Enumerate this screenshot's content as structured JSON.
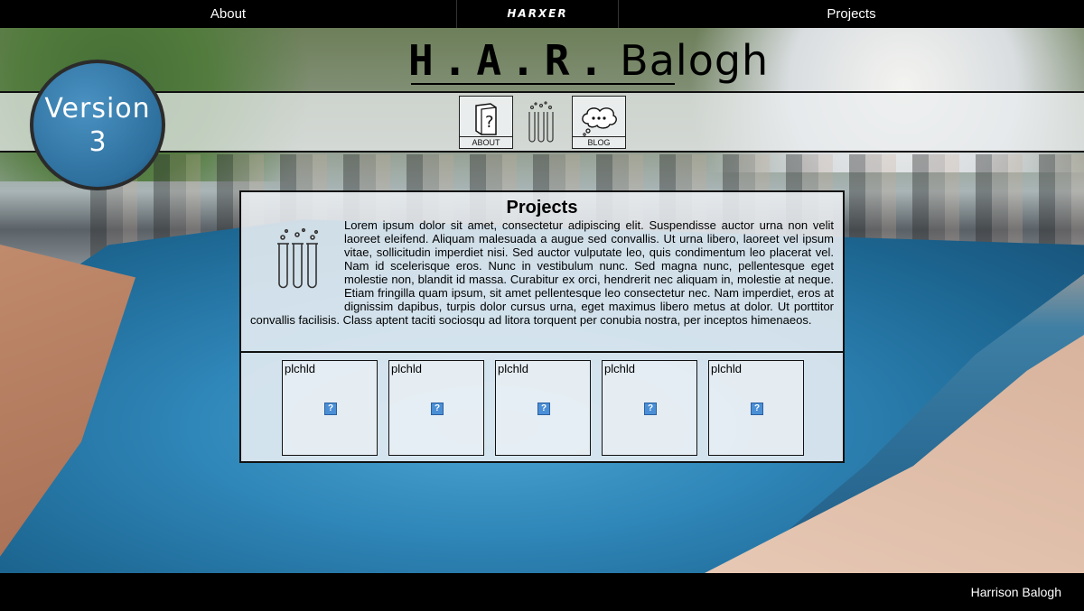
{
  "topnav": {
    "about_label": "About",
    "logo_text": "HARXER",
    "projects_label": "Projects"
  },
  "site_title": {
    "initials": "H.A.R.",
    "surname": "Balogh"
  },
  "version_badge": {
    "label": "Version",
    "number": "3"
  },
  "ribbon": {
    "about_caption": "ABOUT",
    "blog_caption": "BLOG"
  },
  "projects_panel": {
    "title": "Projects",
    "body": "Lorem ipsum dolor sit amet, consectetur adipiscing elit. Suspendisse auctor urna non velit laoreet eleifend. Aliquam malesuada a augue sed convallis. Ut urna libero, laoreet vel ipsum vitae, sollicitudin imperdiet nisi. Sed auctor vulputate leo, quis condimentum leo placerat vel. Nam id scelerisque eros. Nunc in vestibulum nunc. Sed magna nunc, pellentesque eget molestie non, blandit id massa. Curabitur ex orci, hendrerit nec aliquam in, molestie at neque. Etiam fringilla quam ipsum, sit amet pellentesque leo consectetur nec. Nam imperdiet, eros at dignissim dapibus, turpis dolor cursus urna, eget maximus libero metus at dolor. Ut porttitor convallis facilisis. Class aptent taciti sociosqu ad litora torquent per conubia nostra, per inceptos himenaeos.",
    "thumbnails": [
      {
        "label": "plchld"
      },
      {
        "label": "plchld"
      },
      {
        "label": "plchld"
      },
      {
        "label": "plchld"
      },
      {
        "label": "plchld"
      }
    ]
  },
  "footer": {
    "credit": "Harrison Balogh"
  },
  "colors": {
    "nav_bg": "#000000",
    "badge_blue": "#2d6f9d",
    "panel_bg": "#eef1f4"
  },
  "icons": {
    "about": "question-book-icon",
    "projects": "test-tubes-icon",
    "blog": "thought-bubble-icon",
    "broken_image": "broken-image-icon"
  }
}
